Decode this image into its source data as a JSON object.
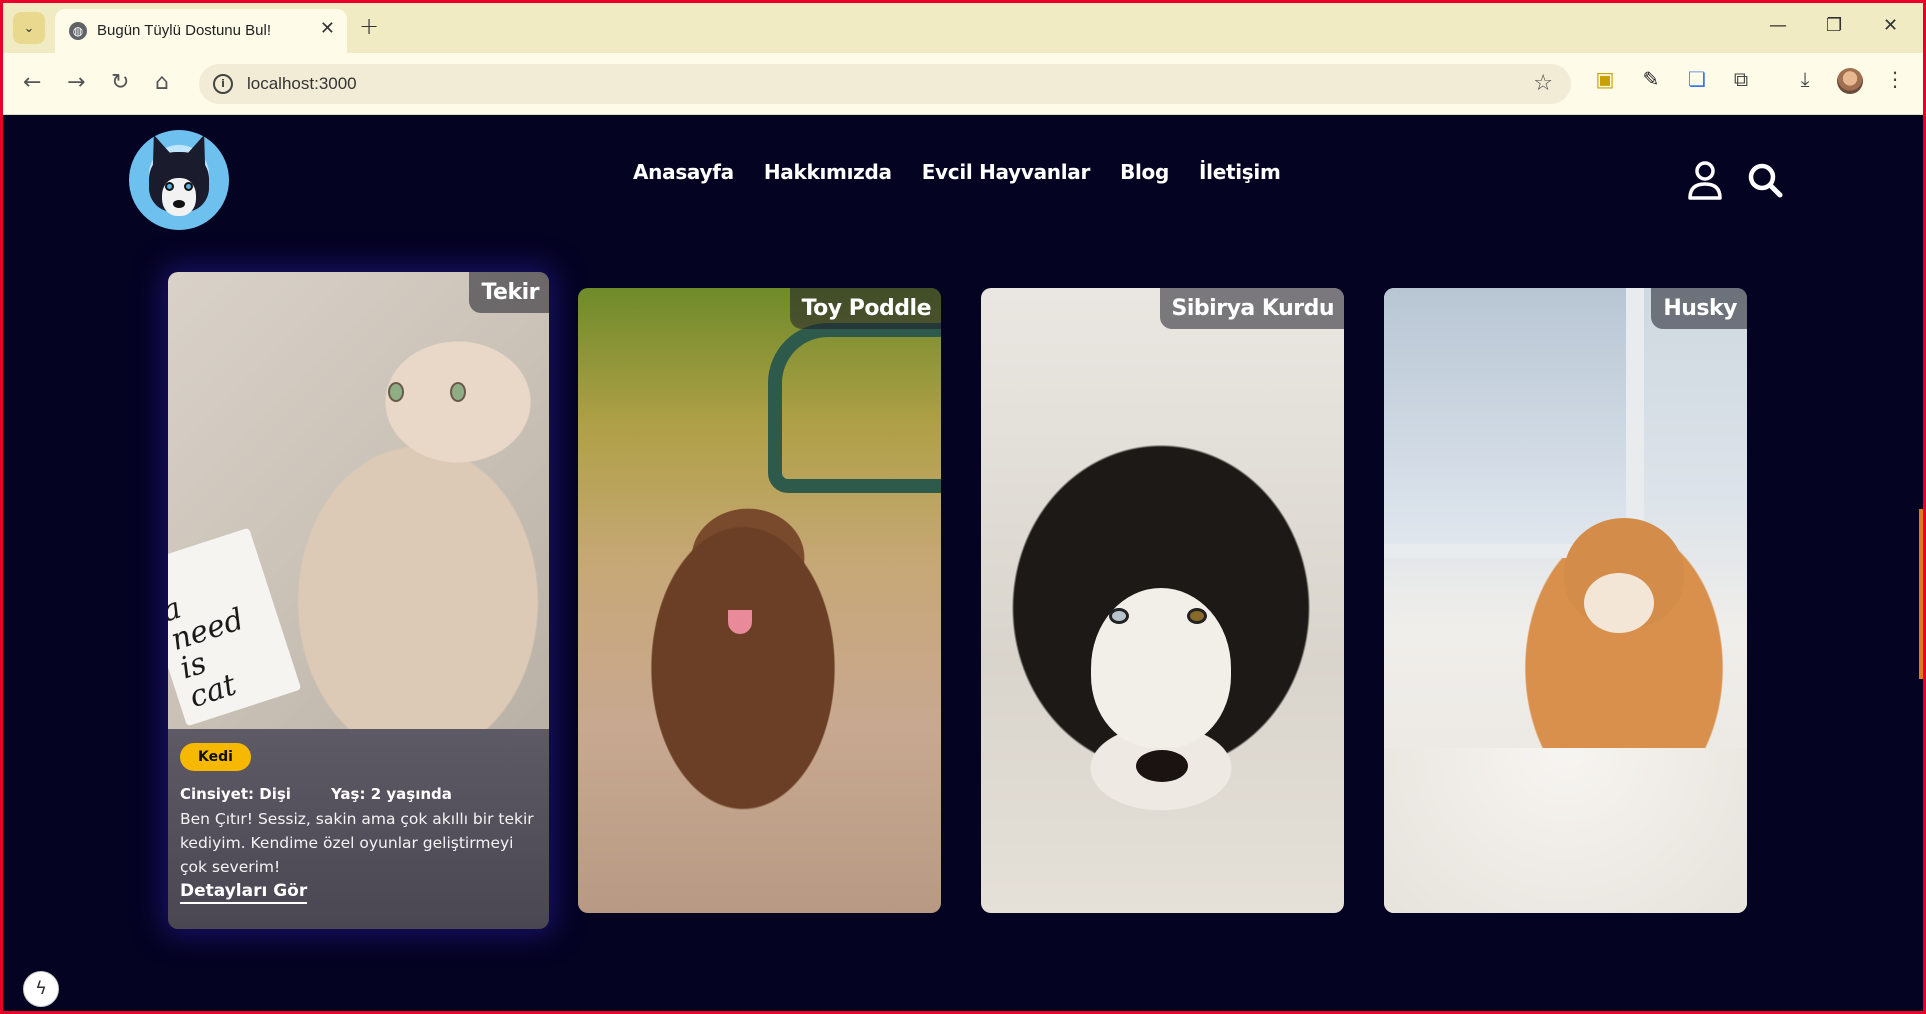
{
  "browser": {
    "tab_title": "Bugün Tüylü Dostunu Bul!",
    "url": "localhost:3000",
    "new_tab_label": "+",
    "tab_close_label": "✕"
  },
  "site": {
    "nav": [
      {
        "label": "Anasayfa"
      },
      {
        "label": "Hakkımızda"
      },
      {
        "label": "Evcil Hayvanlar"
      },
      {
        "label": "Blog"
      },
      {
        "label": "İletişim"
      }
    ]
  },
  "pets": [
    {
      "name": "Tekir",
      "type": "Kedi",
      "gender_label": "Cinsiyet:",
      "gender": "Dişi",
      "age_label": "Yaş:",
      "age": "2 yaşında",
      "description": "Ben Çıtır! Sessiz, sakin ama çok akıllı bir tekir kediyim. Kendime özel oyunlar geliştirmeyi çok severim!",
      "details_link": "Detayları Gör"
    },
    {
      "name": "Toy Poddle"
    },
    {
      "name": "Sibirya Kurdu"
    },
    {
      "name": "Husky"
    }
  ],
  "colors": {
    "page_bg": "#050322",
    "badge": "#f6b800",
    "chrome_bg": "#f1ebc4"
  }
}
